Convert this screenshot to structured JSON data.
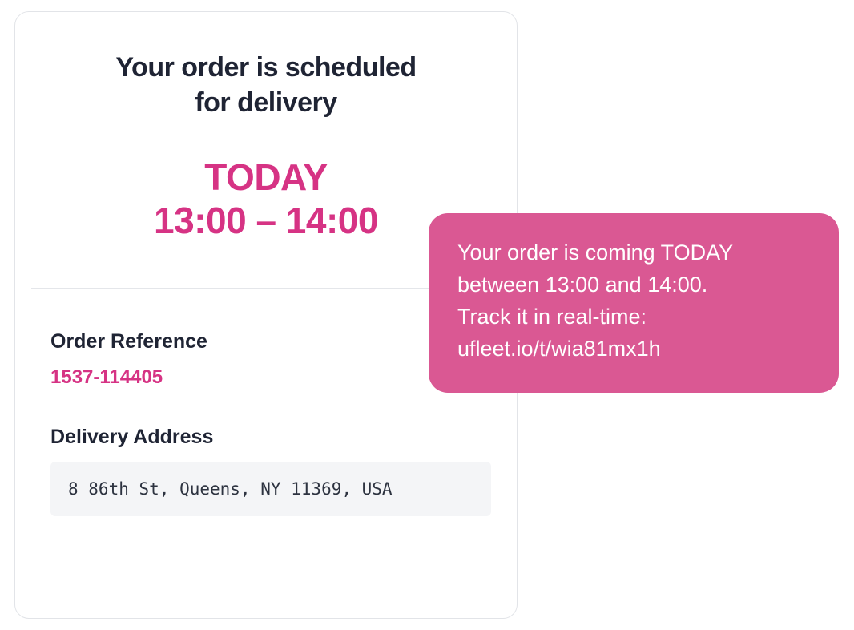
{
  "card": {
    "heading_line1": "Your order is scheduled",
    "heading_line2": "for delivery",
    "day": "TODAY",
    "window": "13:00 – 14:00",
    "order_ref_label": "Order Reference",
    "order_ref_value": "1537-114405",
    "address_label": "Delivery Address",
    "address_value": "8 86th St, Queens, NY 11369, USA"
  },
  "bubble": {
    "line1": "Your order is coming TODAY",
    "line2": "between 13:00 and 14:00.",
    "line3": "Track it in real-time:",
    "line4": "ufleet.io/t/wia81mx1h"
  },
  "colors": {
    "accent": "#d63384",
    "bubble": "#da5893",
    "text_dark": "#1f2434",
    "addr_bg": "#f4f5f7"
  }
}
